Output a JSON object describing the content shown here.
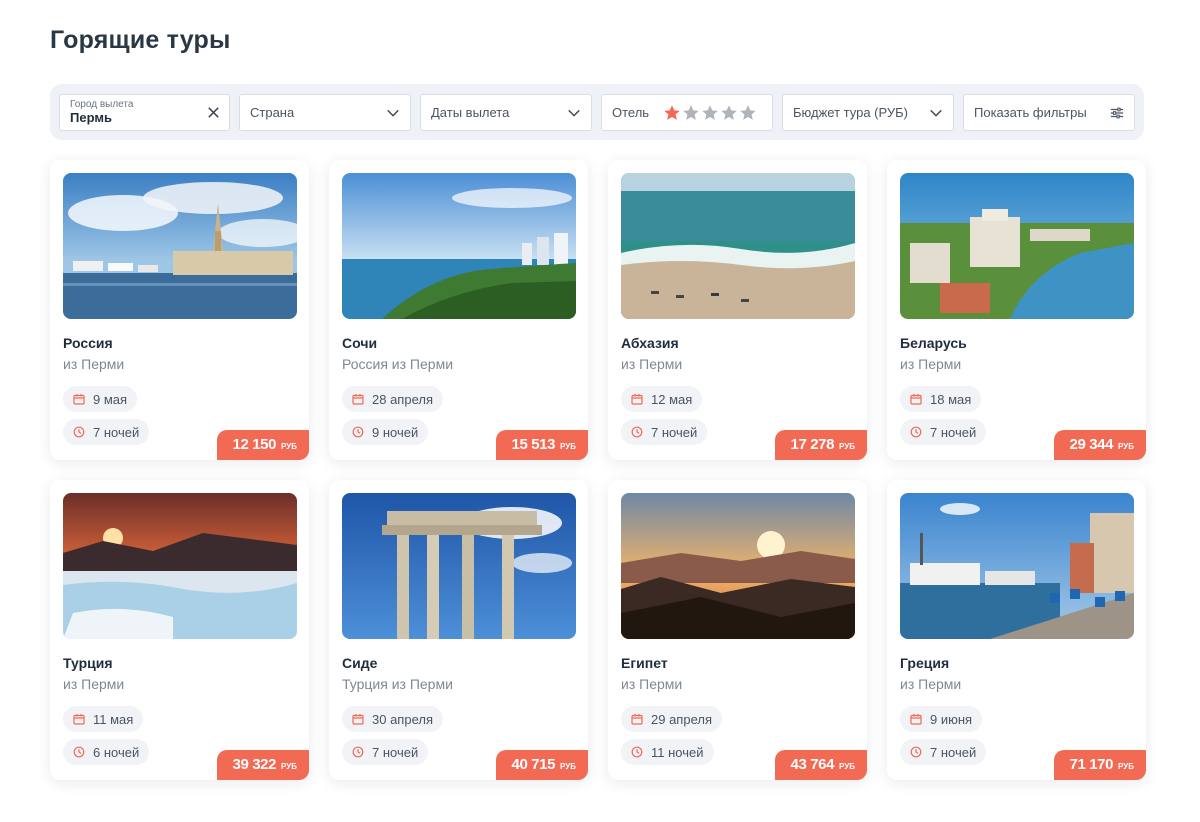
{
  "page": {
    "title": "Горящие туры"
  },
  "filters": {
    "city": {
      "label": "Город вылета",
      "value": "Пермь"
    },
    "country": {
      "placeholder": "Страна"
    },
    "dates": {
      "placeholder": "Даты вылета"
    },
    "hotel": {
      "label": "Отель",
      "stars": 1,
      "max_stars": 5
    },
    "budget": {
      "placeholder": "Бюджет тура (РУБ)"
    },
    "more": {
      "label": "Показать фильтры"
    }
  },
  "colors": {
    "accent": "#f26a54",
    "star_off": "#aeb4ba",
    "chip_bg": "#f1f3f6"
  },
  "currency": "РУБ",
  "tours": [
    {
      "title": "Россия",
      "subtitle": "из Перми",
      "date": "9 мая",
      "nights": "7 ночей",
      "price": "12 150",
      "image": "sochi-seaport-marina"
    },
    {
      "title": "Сочи",
      "subtitle": "Россия из Перми",
      "date": "28 апреля",
      "nights": "9 ночей",
      "price": "15 513",
      "image": "sochi-coast-sea"
    },
    {
      "title": "Абхазия",
      "subtitle": "из Перми",
      "date": "12 мая",
      "nights": "7 ночей",
      "price": "17 278",
      "image": "beach-aerial"
    },
    {
      "title": "Беларусь",
      "subtitle": "из Перми",
      "date": "18 мая",
      "nights": "7 ночей",
      "price": "29 344",
      "image": "minsk-city-lake"
    },
    {
      "title": "Турция",
      "subtitle": "из Перми",
      "date": "11 мая",
      "nights": "6 ночей",
      "price": "39 322",
      "image": "pamukkale-sunset"
    },
    {
      "title": "Сиде",
      "subtitle": "Турция из Перми",
      "date": "30 апреля",
      "nights": "7 ночей",
      "price": "40 715",
      "image": "ancient-columns"
    },
    {
      "title": "Египет",
      "subtitle": "из Перми",
      "date": "29 апреля",
      "nights": "11 ночей",
      "price": "43 764",
      "image": "desert-mountain-sunrise"
    },
    {
      "title": "Греция",
      "subtitle": "из Перми",
      "date": "9 июня",
      "nights": "7 ночей",
      "price": "71 170",
      "image": "harbor-cafe-boats"
    }
  ]
}
